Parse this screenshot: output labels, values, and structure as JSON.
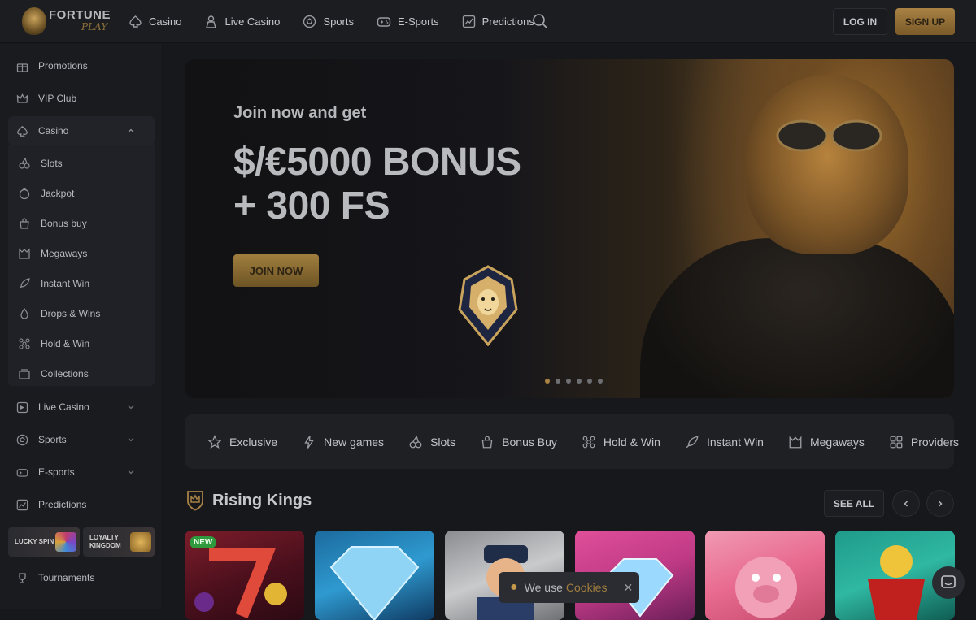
{
  "brand": {
    "line1": "FORTUNE",
    "line2": "PLAY"
  },
  "nav": [
    {
      "label": "Casino",
      "icon": "casino-icon"
    },
    {
      "label": "Live Casino",
      "icon": "live-casino-icon"
    },
    {
      "label": "Sports",
      "icon": "sports-ball-icon"
    },
    {
      "label": "E-Sports",
      "icon": "gamepad-icon"
    },
    {
      "label": "Predictions",
      "icon": "chart-icon"
    }
  ],
  "auth": {
    "login": "LOG IN",
    "signup": "SIGN UP"
  },
  "sidebar": {
    "items": [
      {
        "label": "Promotions"
      },
      {
        "label": "VIP Club"
      },
      {
        "label": "Casino"
      }
    ],
    "casino_sub": [
      {
        "label": "Slots"
      },
      {
        "label": "Jackpot"
      },
      {
        "label": "Bonus buy"
      },
      {
        "label": "Megaways"
      },
      {
        "label": "Instant Win"
      },
      {
        "label": "Drops & Wins"
      },
      {
        "label": "Hold & Win"
      },
      {
        "label": "Collections"
      }
    ],
    "lower": [
      {
        "label": "Live Casino"
      },
      {
        "label": "Sports"
      },
      {
        "label": "E-sports"
      },
      {
        "label": "Predictions"
      }
    ],
    "promo_cards": [
      {
        "label": "LUCKY SPIN"
      },
      {
        "label_line1": "LOYALTY",
        "label_line2": "KINGDOM"
      }
    ],
    "tournaments": "Tournaments"
  },
  "hero": {
    "subtitle": "Join now and get",
    "title_line1": "$/€5000 BONUS",
    "title_line2": "+ 300 FS",
    "cta": "JOIN NOW",
    "slides": 6,
    "active_slide": 1
  },
  "categories": [
    {
      "label": "Exclusive"
    },
    {
      "label": "New games"
    },
    {
      "label": "Slots"
    },
    {
      "label": "Bonus Buy"
    },
    {
      "label": "Hold & Win"
    },
    {
      "label": "Instant Win"
    },
    {
      "label": "Megaways"
    },
    {
      "label": "Providers"
    }
  ],
  "section": {
    "title": "Rising Kings",
    "see_all": "SEE ALL"
  },
  "games": [
    {
      "badge": "NEW"
    }
  ],
  "cookie": {
    "text": "We use",
    "link": "Cookies",
    "close": "✕"
  },
  "colors": {
    "accent_gold": "#a98244",
    "bg": "#17181c",
    "panel": "#1f2024",
    "new_badge": "#2f9a3d"
  }
}
